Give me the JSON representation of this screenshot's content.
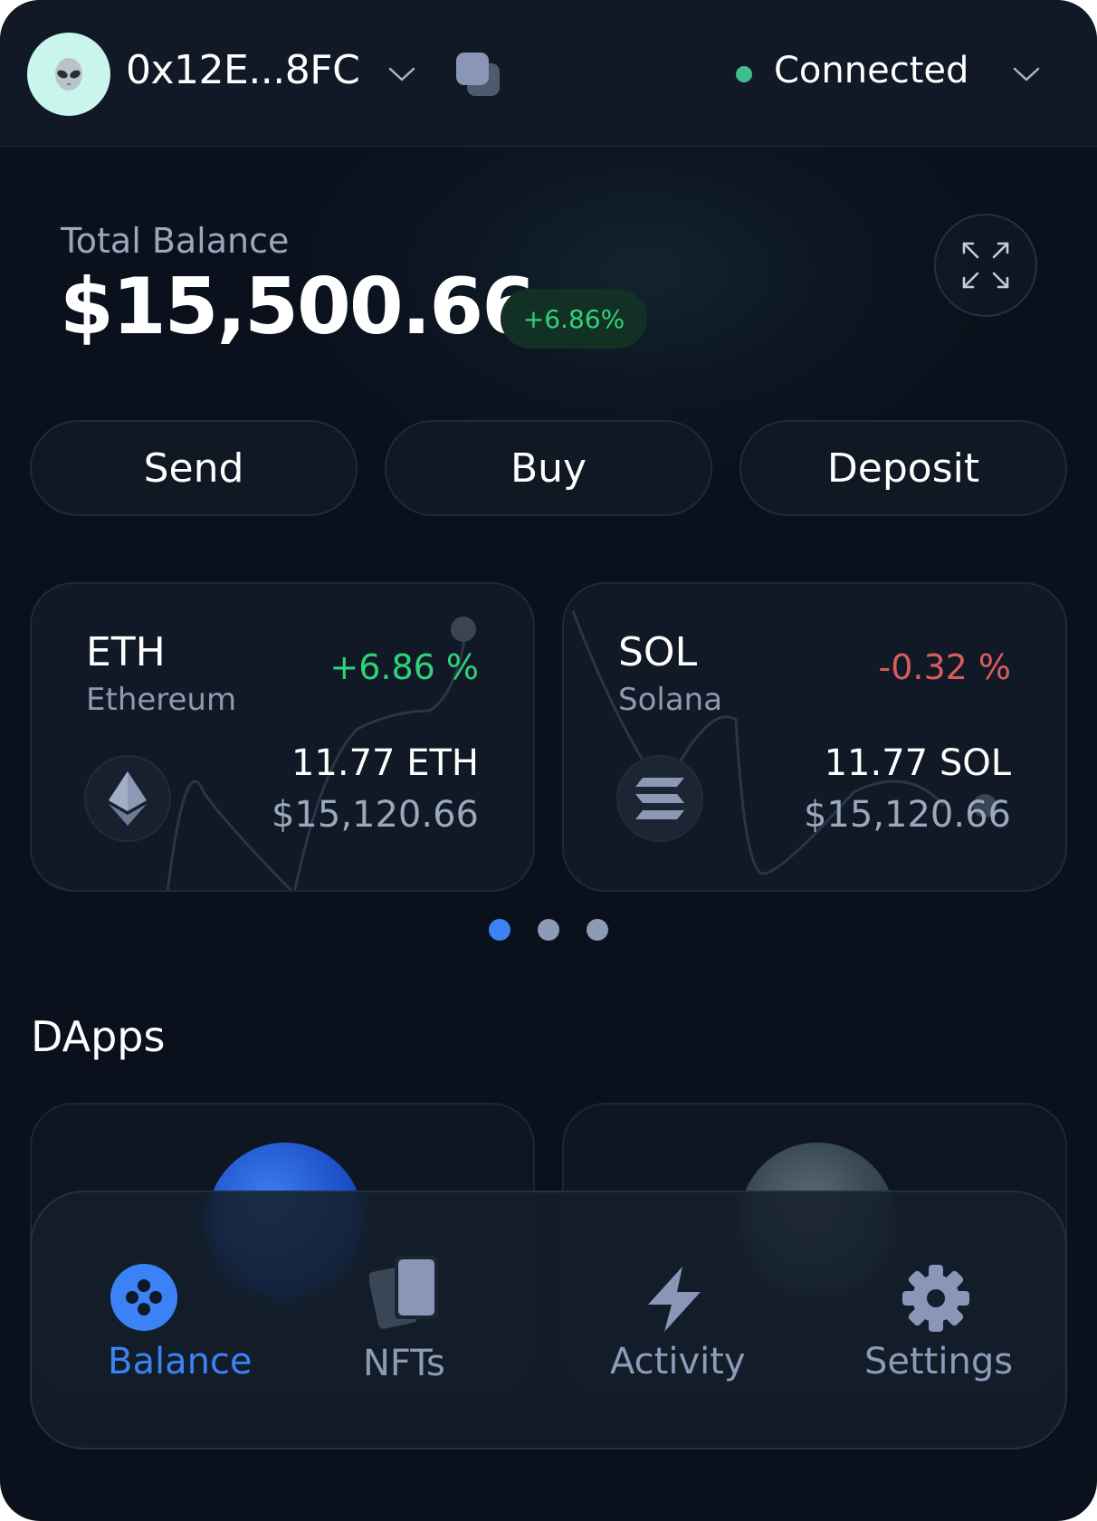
{
  "header": {
    "avatar_icon": "alien-emoji-icon",
    "wallet_address": "0x12E...8FC",
    "copy_icon": "copy-icon",
    "connection_status": "Connected",
    "status_color": "#3fbf8f"
  },
  "balance": {
    "label": "Total Balance",
    "value": "$15,500.66",
    "change": "+6.86%",
    "expand_icon": "expand-icon"
  },
  "actions": {
    "send": "Send",
    "buy": "Buy",
    "deposit": "Deposit"
  },
  "tokens": [
    {
      "symbol": "ETH",
      "name": "Ethereum",
      "change": "+6.86 %",
      "amount": "11.77 ETH",
      "value": "$15,120.66",
      "trend": "up",
      "icon": "ethereum-icon"
    },
    {
      "symbol": "SOL",
      "name": "Solana",
      "change": "-0.32 %",
      "amount": "11.77 SOL",
      "value": "$15,120.66",
      "trend": "down",
      "icon": "solana-icon"
    }
  ],
  "pager": {
    "pages": 3,
    "active": 1
  },
  "dapps": {
    "title": "DApps"
  },
  "nav": {
    "items": [
      {
        "label": "Balance",
        "icon": "balance-icon",
        "active": true
      },
      {
        "label": "NFTs",
        "icon": "nfts-icon",
        "active": false
      },
      {
        "label": "Activity",
        "icon": "lightning-icon",
        "active": false
      },
      {
        "label": "Settings",
        "icon": "gear-icon",
        "active": false
      }
    ]
  },
  "colors": {
    "background": "#0a111c",
    "accent": "#3b82f6",
    "positive": "#2fd27a",
    "negative": "#d85d5d",
    "muted": "#8d9bb8"
  }
}
